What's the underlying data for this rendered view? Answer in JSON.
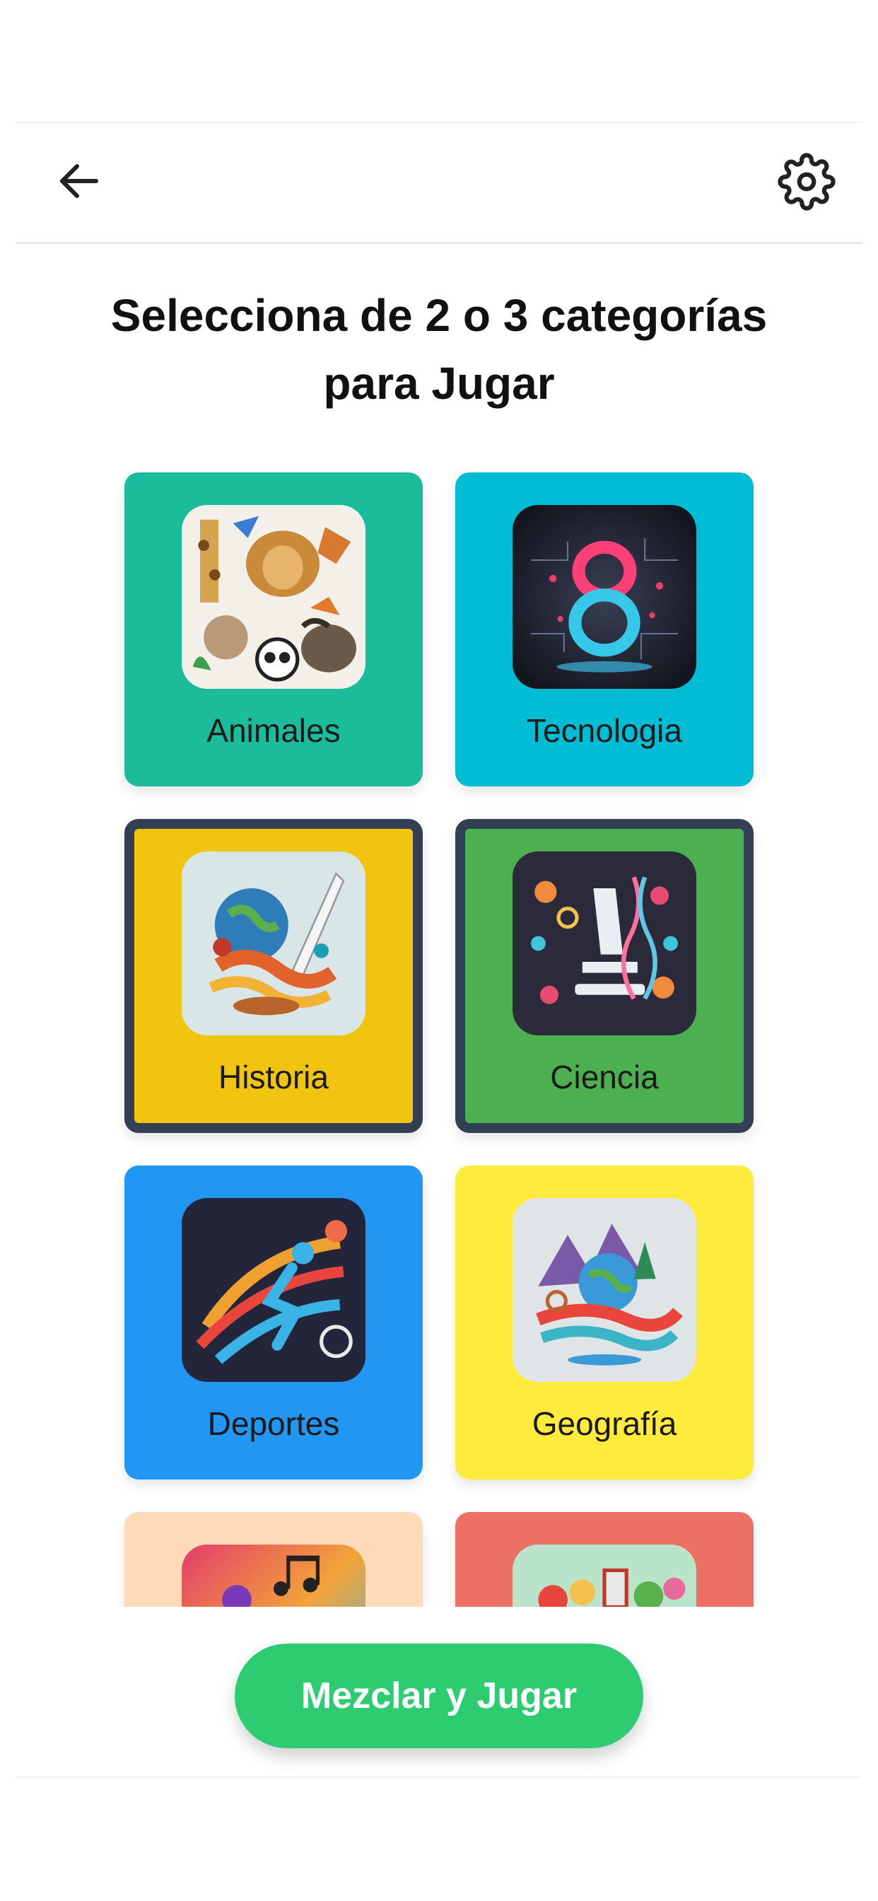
{
  "header": {
    "back_icon": "arrow-left-icon",
    "settings_icon": "gear-icon"
  },
  "title": {
    "line1": "Selecciona de 2 o 3 categorías",
    "line2": "para Jugar"
  },
  "categories": [
    {
      "label": "Animales",
      "color": "#1abc9c",
      "selected": false,
      "icon": "animals-collage-image"
    },
    {
      "label": "Tecnologia",
      "color": "#00bcd4",
      "selected": false,
      "icon": "tech-8-image"
    },
    {
      "label": "Historia",
      "color": "#f1c40f",
      "selected": true,
      "icon": "history-globe-quill-image"
    },
    {
      "label": "Ciencia",
      "color": "#4caf50",
      "selected": true,
      "icon": "science-microscope-image"
    },
    {
      "label": "Deportes",
      "color": "#2196f3",
      "selected": false,
      "icon": "sports-runner-image"
    },
    {
      "label": "Geografía",
      "color": "#ffeb3b",
      "selected": false,
      "icon": "geography-globe-image"
    },
    {
      "label": "",
      "color": "#ffdab9",
      "selected": false,
      "icon": "music-notes-image"
    },
    {
      "label": "",
      "color": "#ec7063",
      "selected": false,
      "icon": "food-collage-image"
    }
  ],
  "play_button": {
    "label": "Mezclar y Jugar",
    "color": "#2ecc71"
  }
}
